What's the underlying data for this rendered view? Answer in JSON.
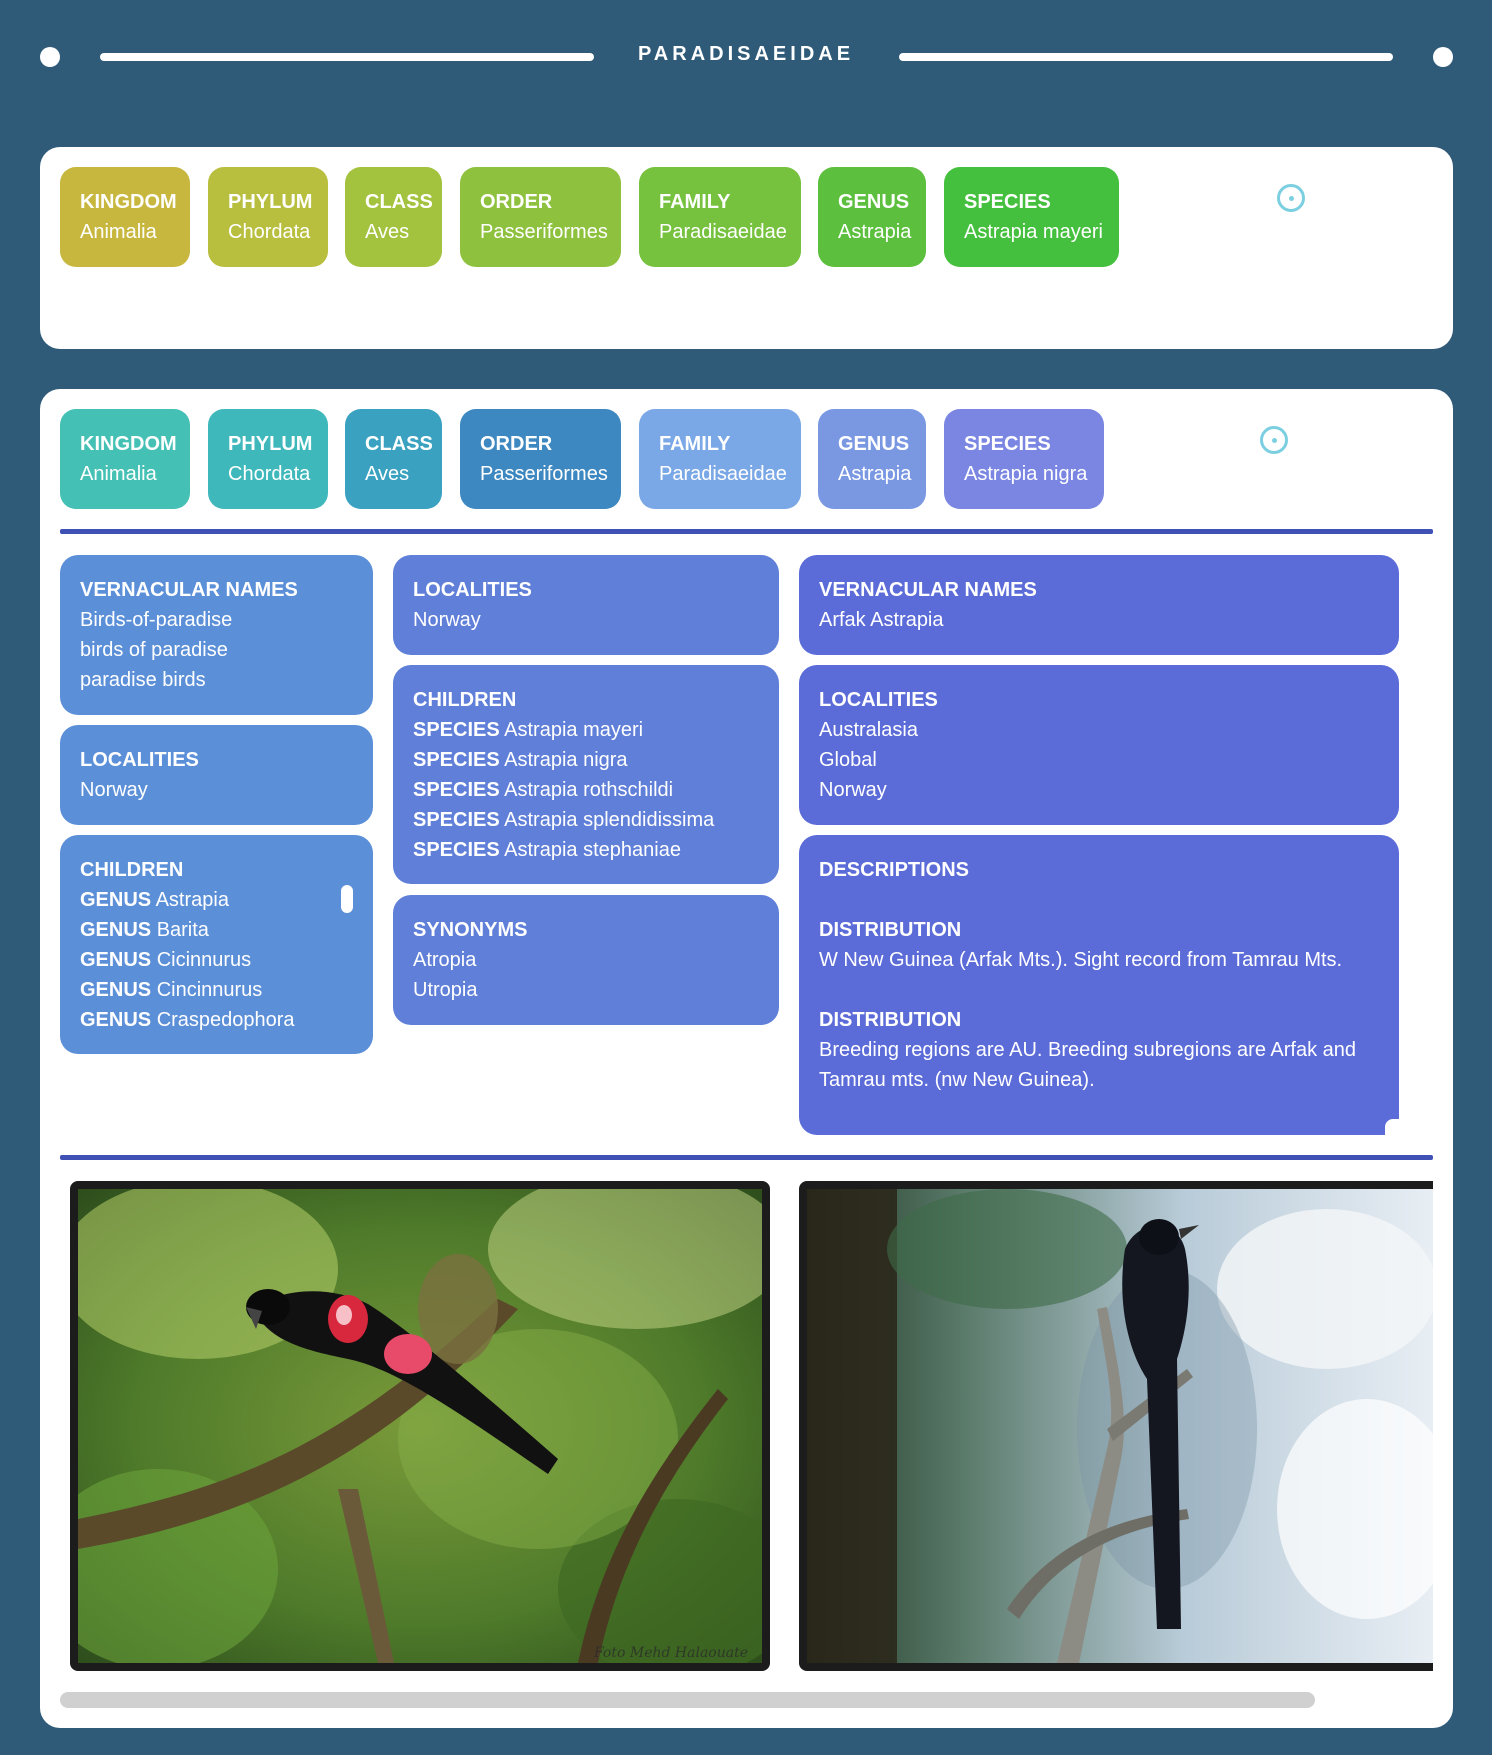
{
  "header": {
    "title": "PARADISAEIDAE"
  },
  "taxonomy_1": [
    {
      "rank": "KINGDOM",
      "name": "Animalia",
      "color": "#c8b73e"
    },
    {
      "rank": "PHYLUM",
      "name": "Chordata",
      "color": "#b8bf3e"
    },
    {
      "rank": "CLASS",
      "name": "Aves",
      "color": "#a3c23e"
    },
    {
      "rank": "ORDER",
      "name": "Passeriformes",
      "color": "#8ec13e"
    },
    {
      "rank": "FAMILY",
      "name": "Paradisaeidae",
      "color": "#76c13e"
    },
    {
      "rank": "GENUS",
      "name": "Astrapia",
      "color": "#5cc03e"
    },
    {
      "rank": "SPECIES",
      "name": "Astrapia mayeri",
      "color": "#45c03e"
    }
  ],
  "taxonomy_2": [
    {
      "rank": "KINGDOM",
      "name": "Animalia",
      "color": "#44c0b4"
    },
    {
      "rank": "PHYLUM",
      "name": "Chordata",
      "color": "#3fb8bc"
    },
    {
      "rank": "CLASS",
      "name": "Aves",
      "color": "#3aa1c0"
    },
    {
      "rank": "ORDER",
      "name": "Passeriformes",
      "color": "#3d88c0"
    },
    {
      "rank": "FAMILY",
      "name": "Paradisaeidae",
      "color": "#7aa8e6"
    },
    {
      "rank": "GENUS",
      "name": "Astrapia",
      "color": "#7a98e2"
    },
    {
      "rank": "SPECIES",
      "name": "Astrapia nigra",
      "color": "#7a86e2"
    }
  ],
  "col1": {
    "vernacular": {
      "heading": "VERNACULAR NAMES",
      "items": [
        "Birds-of-paradise",
        "birds of paradise",
        "paradise birds"
      ]
    },
    "localities": {
      "heading": "LOCALITIES",
      "items": [
        "Norway"
      ]
    },
    "children": {
      "heading": "CHILDREN",
      "rank": "GENUS",
      "items": [
        "Astrapia",
        "Barita",
        "Cicinnurus",
        "Cincinnurus",
        "Craspedophora"
      ]
    }
  },
  "col2": {
    "localities": {
      "heading": "LOCALITIES",
      "items": [
        "Norway"
      ]
    },
    "children": {
      "heading": "CHILDREN",
      "rank": "SPECIES",
      "items": [
        "Astrapia mayeri",
        "Astrapia nigra",
        "Astrapia rothschildi",
        "Astrapia splendidissima",
        "Astrapia stephaniae"
      ]
    },
    "synonyms": {
      "heading": "SYNONYMS",
      "items": [
        "Atropia",
        "Utropia"
      ]
    }
  },
  "col3": {
    "vernacular": {
      "heading": "VERNACULAR NAMES",
      "items": [
        "Arfak Astrapia"
      ]
    },
    "localities": {
      "heading": "LOCALITIES",
      "items": [
        "Australasia",
        "Global",
        "Norway"
      ]
    },
    "descriptions": {
      "heading": "DESCRIPTIONS",
      "distribution_1": {
        "heading": "DISTRIBUTION",
        "text": "W New Guinea (Arfak Mts.). Sight record from Tamrau Mts."
      },
      "distribution_2": {
        "heading": "DISTRIBUTION",
        "text": "Breeding regions are AU. Breeding subregions are Arfak and Tamrau mts. (nw New Guinea)."
      }
    }
  },
  "photos": {
    "photo1_watermark": "Foto Mehd Halaouate"
  }
}
